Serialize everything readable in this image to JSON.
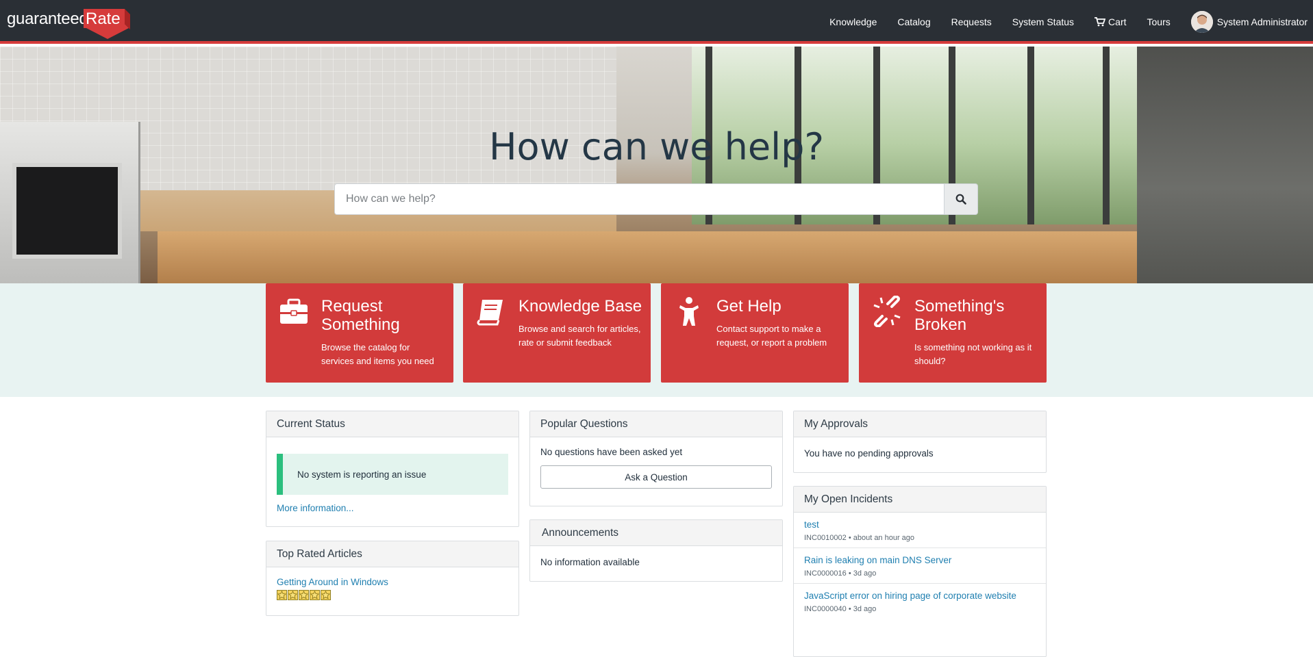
{
  "header": {
    "logo_text_1": "guaranteed",
    "logo_text_2": "Rate",
    "nav": {
      "knowledge": "Knowledge",
      "catalog": "Catalog",
      "requests": "Requests",
      "system_status": "System Status",
      "cart": "Cart",
      "tours": "Tours",
      "user": "System Administrator"
    }
  },
  "hero": {
    "title": "How can we help?",
    "search_placeholder": "How can we help?"
  },
  "tiles": [
    {
      "title": "Request Something",
      "desc": "Browse the catalog for services and items you need",
      "icon": "briefcase-icon"
    },
    {
      "title": "Knowledge Base",
      "desc": "Browse and search for articles, rate or submit feedback",
      "icon": "book-icon"
    },
    {
      "title": "Get Help",
      "desc": "Contact support to make a request, or report a problem",
      "icon": "person-icon"
    },
    {
      "title": "Something's Broken",
      "desc": "Is something not working as it should?",
      "icon": "broken-link-icon"
    }
  ],
  "current_status": {
    "title": "Current Status",
    "message": "No system is reporting an issue",
    "more_link": "More information..."
  },
  "top_rated": {
    "title": "Top Rated Articles",
    "article": "Getting Around in Windows",
    "rating": 5
  },
  "popular_questions": {
    "title": "Popular Questions",
    "message": "No questions have been asked yet",
    "button": "Ask a Question"
  },
  "announcements": {
    "title": "Announcements",
    "message": "No information available"
  },
  "approvals": {
    "title": "My Approvals",
    "message": "You have no pending approvals"
  },
  "incidents": {
    "title": "My Open Incidents",
    "items": [
      {
        "title": "test",
        "meta": "INC0010002 • about an hour ago"
      },
      {
        "title": "Rain is leaking on main DNS Server",
        "meta": "INC0000016 • 3d ago"
      },
      {
        "title": "JavaScript error on hiring page of corporate website",
        "meta": "INC0000040 • 3d ago"
      }
    ]
  },
  "colors": {
    "header_bg": "#2a2f35",
    "accent_red": "#d23b3b",
    "band_bg": "#e8f3f2",
    "link_blue": "#1f7fb0",
    "status_green": "#2bbf7e"
  }
}
